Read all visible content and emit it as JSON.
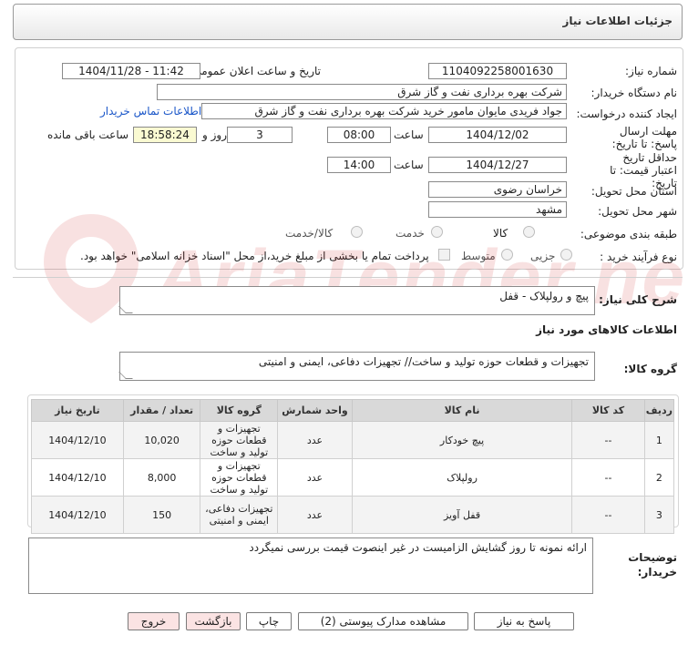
{
  "header": {
    "title": "جزئیات اطلاعات نیاز"
  },
  "form": {
    "need_number": {
      "label": "شماره نیاز:",
      "value": "1104092258001630"
    },
    "announce_datetime": {
      "label": "تاریخ و ساعت اعلان عمومی:",
      "value": "1404/11/28 - 11:42"
    },
    "buyer_org": {
      "label": "نام دستگاه خریدار:",
      "value": "شرکت بهره برداری نفت و گاز شرق"
    },
    "requester": {
      "label": "ایجاد کننده درخواست:",
      "value": "جواد فریدی مایوان مامور خرید شرکت بهره برداری نفت و گاز شرق"
    },
    "contact_link": "اطلاعات تماس خریدار",
    "reply_deadline": {
      "label": "مهلت ارسال پاسخ: تا تاریخ:",
      "date": "1404/12/02",
      "time_label": "ساعت",
      "time": "08:00",
      "days": "3",
      "days_label": "روز و",
      "remaining": "18:58:24",
      "remaining_label": "ساعت باقی مانده"
    },
    "price_validity": {
      "label": "حداقل تاریخ اعتبار قیمت: تا تاریخ:",
      "date": "1404/12/27",
      "time_label": "ساعت",
      "time": "14:00"
    },
    "province": {
      "label": "استان محل تحویل:",
      "value": "خراسان رضوی"
    },
    "city": {
      "label": "شهر محل تحویل:",
      "value": "مشهد"
    },
    "category": {
      "label": "طبقه بندی موضوعی:",
      "options": [
        "کالا",
        "خدمت",
        "کالا/خدمت"
      ]
    },
    "process_type": {
      "label": "نوع فرآیند خرید :",
      "options": [
        "جزیی",
        "متوسط"
      ],
      "payment_note": "پرداخت تمام یا بخشی از مبلغ خرید،از محل \"اسناد خزانه اسلامی\" خواهد بود."
    }
  },
  "summary": {
    "label": "شرح کلی نیاز:",
    "value": "پیچ و رولپلاک - قفل"
  },
  "goods_info_title": "اطلاعات کالاهای مورد نیاز",
  "goods_group": {
    "label": "گروه کالا:",
    "value": "تجهیزات و قطعات حوزه تولید و ساخت// تجهیزات دفاعی، ایمنی و امنیتی"
  },
  "table": {
    "headers": [
      "ردیف",
      "کد کالا",
      "نام کالا",
      "واحد شمارش",
      "گروه کالا",
      "تعداد / مقدار",
      "تاریخ نیاز"
    ],
    "rows": [
      [
        "1",
        "--",
        "پیچ خودکار",
        "عدد",
        "تجهیزات و قطعات حوزه تولید و ساخت",
        "10,020",
        "1404/12/10"
      ],
      [
        "2",
        "--",
        "رولپلاک",
        "عدد",
        "تجهیزات و قطعات حوزه تولید و ساخت",
        "8,000",
        "1404/12/10"
      ],
      [
        "3",
        "--",
        "قفل آویز",
        "عدد",
        "تجهیزات دفاعی، ایمنی و امنیتی",
        "150",
        "1404/12/10"
      ]
    ]
  },
  "buyer_notes": {
    "label": "توضیحات خریدار:",
    "value": "ارائه نمونه تا روز گشایش الزامیست در غیر اینصوت قیمت بررسی نمیگردد"
  },
  "buttons": {
    "reply": "پاسخ به نیاز",
    "view_docs": "مشاهده مدارک پیوستی (2)",
    "print": "چاپ",
    "back": "بازگشت",
    "exit": "خروج"
  },
  "watermark": "AriaTender.net"
}
